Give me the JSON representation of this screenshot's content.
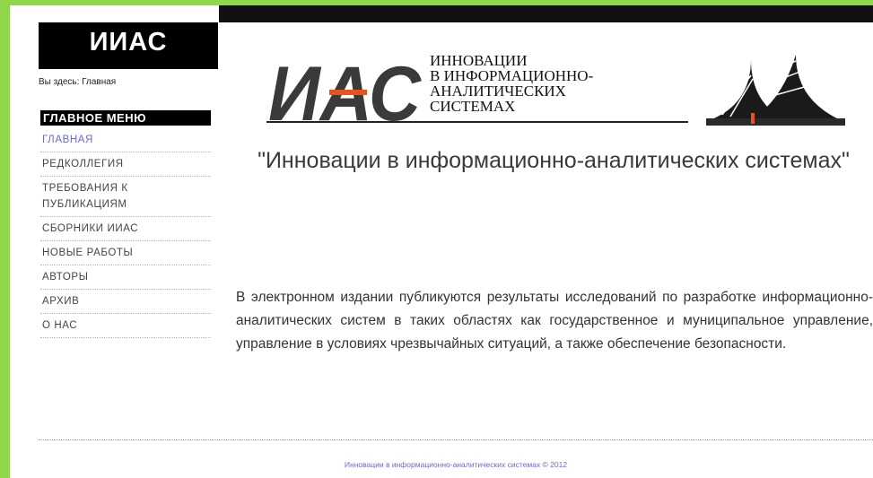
{
  "site": {
    "title": "ИИАС"
  },
  "breadcrumb": "Вы здесь: Главная",
  "menu": {
    "heading": "ГЛАВНОЕ МЕНЮ",
    "items": [
      {
        "label": "ГЛАВНАЯ",
        "active": true
      },
      {
        "label": "РЕДКОЛЛЕГИЯ"
      },
      {
        "label": "ТРЕБОВАНИЯ К ПУБЛИКАЦИЯМ"
      },
      {
        "label": "СБОРНИКИ ИИАС"
      },
      {
        "label": "НОВЫЕ РАБОТЫ"
      },
      {
        "label": "АВТОРЫ"
      },
      {
        "label": "АРХИВ"
      },
      {
        "label": "О НАС"
      }
    ]
  },
  "banner": {
    "logo_letters": "ИАС",
    "lines": [
      "ИННОВАЦИИ",
      "В ИНФОРМАЦИОННО-",
      "АНАЛИТИЧЕСКИХ",
      "СИСТЕМАХ"
    ]
  },
  "headline": "\"Инновации в информационно-аналитических системах\"",
  "description": "В электронном издании публикуются результаты исследований по разработке информационно-аналитических систем в таких областях как государственное и муниципальное управление, управление в условиях чрезвычайных ситуаций, а также обеспечение безопасности.",
  "footer": "Инновации в информационно-аналитических системах © 2012",
  "colors": {
    "accent_green": "#8ed84a",
    "link_purple": "#6a6ad0",
    "logo_orange": "#e8521c"
  }
}
